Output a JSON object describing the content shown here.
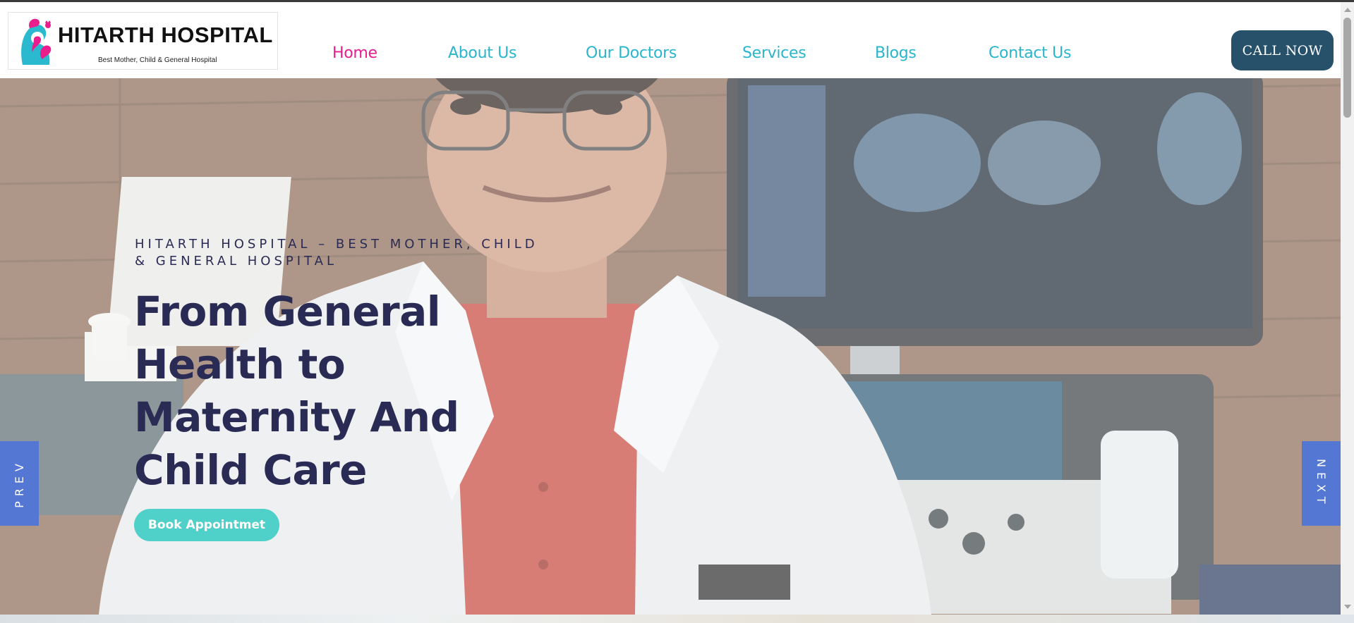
{
  "header": {
    "logo": {
      "title": "HITARTH HOSPITAL",
      "subtitle": "Best Mother, Child & General Hospital"
    },
    "nav": [
      {
        "label": "Home",
        "active": true
      },
      {
        "label": "About Us",
        "active": false
      },
      {
        "label": "Our Doctors",
        "active": false
      },
      {
        "label": "Services",
        "active": false
      },
      {
        "label": "Blogs",
        "active": false
      },
      {
        "label": "Contact Us",
        "active": false
      }
    ],
    "call_label": "CALL NOW"
  },
  "hero": {
    "eyebrow": "HITARTH HOSPITAL – BEST MOTHER, CHILD & GENERAL HOSPITAL",
    "title": "From General Health to Maternity And Child Care",
    "cta_label": "Book Appointmet",
    "prev_label": "PREV",
    "next_label": "NEXT"
  },
  "colors": {
    "nav_text": "#29b5cc",
    "nav_active": "#e91e8c",
    "call_button": "#27506b",
    "hero_text": "#2a2b55",
    "cta_button": "#4fd0c8",
    "side_tabs": "#5577d4"
  }
}
